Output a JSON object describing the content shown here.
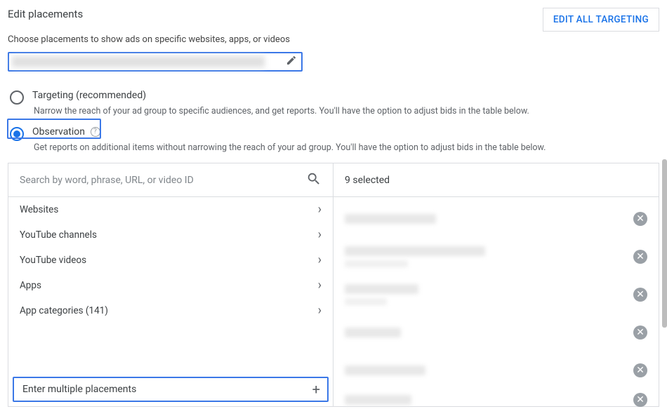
{
  "header": {
    "title": "Edit placements",
    "edit_all_btn": "EDIT ALL TARGETING",
    "subtitle": "Choose placements to show ads on specific websites, apps, or videos"
  },
  "radios": {
    "targeting": {
      "label": "Targeting (recommended)",
      "description": "Narrow the reach of your ad group to specific audiences, and get reports. You'll have the option to adjust bids in the table below."
    },
    "observation": {
      "label": "Observation",
      "description": "Get reports on additional items without narrowing the reach of your ad group. You'll have the option to adjust bids in the table below."
    }
  },
  "search": {
    "placeholder": "Search by word, phrase, URL, or video ID"
  },
  "categories": [
    {
      "label": "Websites"
    },
    {
      "label": "YouTube channels"
    },
    {
      "label": "YouTube videos"
    },
    {
      "label": "Apps"
    },
    {
      "label": "App categories (141)"
    }
  ],
  "enter_multiple": {
    "label": "Enter multiple placements"
  },
  "selected": {
    "header": "9 selected",
    "count": 9
  }
}
